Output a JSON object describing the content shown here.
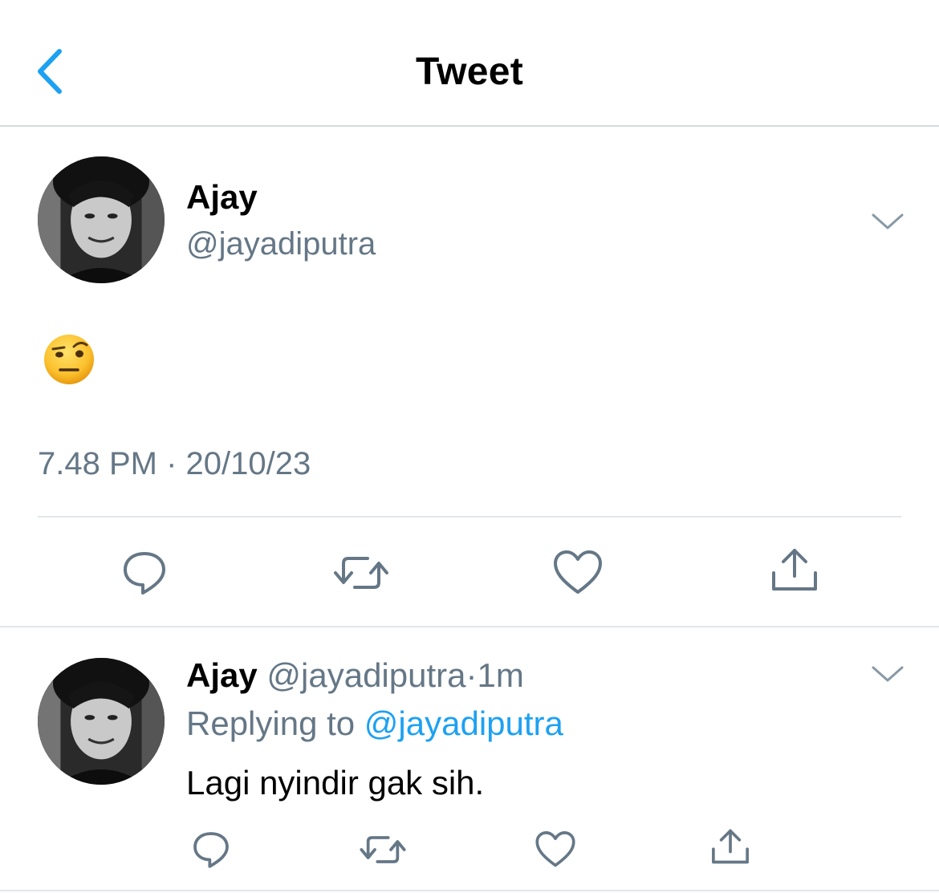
{
  "colors": {
    "accent": "#1da1f2",
    "secondary_text": "#657786",
    "divider": "#e1e6ea"
  },
  "header": {
    "title": "Tweet",
    "back_icon": "chevron-left-icon"
  },
  "main_tweet": {
    "name": "Ajay",
    "handle": "@jayadiputra",
    "content_emoji": "face-with-raised-eyebrow",
    "time": "7.48 PM",
    "separator": "·",
    "date": "20/10/23",
    "actions": [
      "reply-icon",
      "retweet-icon",
      "like-icon",
      "share-icon"
    ]
  },
  "reply_tweet": {
    "name": "Ajay",
    "handle": "@jayadiputra",
    "dot": "·",
    "time": "1m",
    "replying_label": "Replying to",
    "replying_to": "@jayadiputra",
    "text": "Lagi nyindir gak sih.",
    "actions": [
      "reply-icon",
      "retweet-icon",
      "like-icon",
      "share-icon"
    ]
  }
}
